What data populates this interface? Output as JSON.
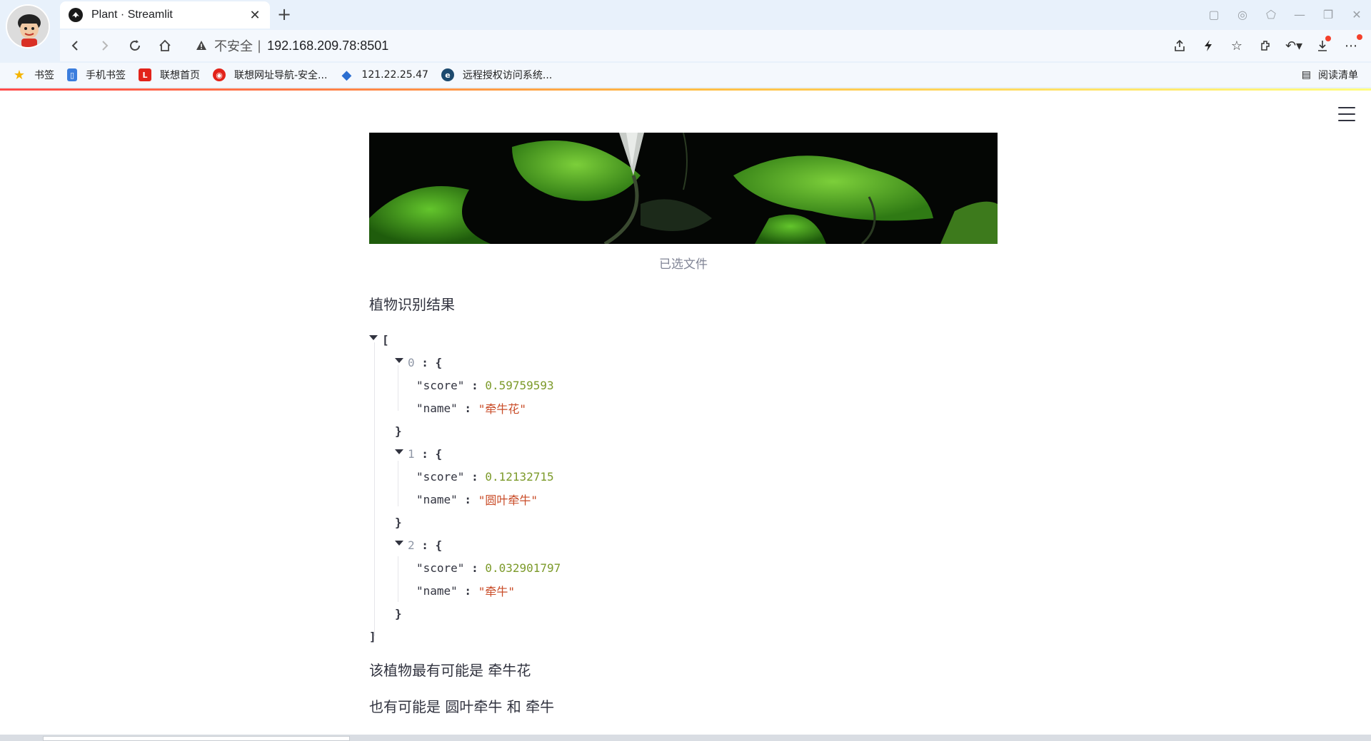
{
  "browser": {
    "tab": {
      "title": "Plant · Streamlit"
    },
    "address": {
      "security_label": "不安全",
      "url": "192.168.209.78:8501"
    },
    "bookmarks": [
      {
        "label": "书签",
        "icon": "star-icon",
        "color": "#f5b400"
      },
      {
        "label": "手机书签",
        "icon": "phone-icon",
        "color": "#3b7ddd"
      },
      {
        "label": "联想首页",
        "icon": "lenovo-icon",
        "color": "#e2231a"
      },
      {
        "label": "联想网址导航-安全...",
        "icon": "lenovo-nav-icon",
        "color": "#e2231a"
      },
      {
        "label": "121.22.25.47",
        "icon": "cube-icon",
        "color": "#2c6fd1"
      },
      {
        "label": "远程授权访问系统...",
        "icon": "remote-icon",
        "color": "#1d4a6e"
      }
    ],
    "reading_list": "阅读清单"
  },
  "page": {
    "image_caption": "已选文件",
    "result_heading": "植物识别结果",
    "results": [
      {
        "index": "0",
        "score": "0.59759593",
        "name": "\"牵牛花\""
      },
      {
        "index": "1",
        "score": "0.12132715",
        "name": "\"圆叶牵牛\""
      },
      {
        "index": "2",
        "score": "0.032901797",
        "name": "\"牵牛\""
      }
    ],
    "json_keys": {
      "score": "\"score\"",
      "name": "\"name\""
    },
    "conclusion_primary": "该植物最有可能是 牵牛花",
    "conclusion_secondary": "也有可能是 圆叶牵牛 和 牵牛"
  },
  "colors": {
    "accent_gradient": [
      "#ff4b4b",
      "#ffbd45",
      "#fffd80"
    ],
    "number": "#7c9a2a",
    "string": "#c94c28"
  }
}
